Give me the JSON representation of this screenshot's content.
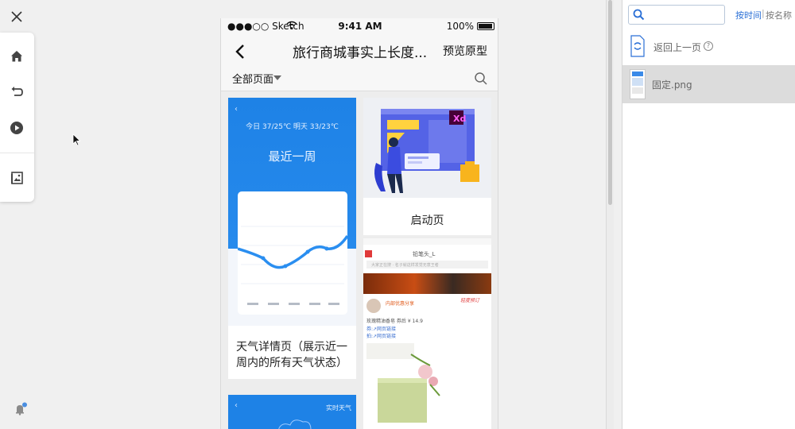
{
  "phone": {
    "status_bar": {
      "carrier": "●●●○○ Sketch",
      "time": "9:41 AM",
      "battery": "100%"
    },
    "nav": {
      "title": "旅行商城事实上长度...",
      "preview_label": "预览原型"
    },
    "filter": {
      "label": "全部页面"
    },
    "cards": {
      "weather": {
        "label": "天气详情页（展示近一周内的所有天气状态）",
        "temps": "今日 37/25℃    明天 33/23℃",
        "heading": "最近一周"
      },
      "launch": {
        "label": "启动页",
        "badge": "Xd"
      },
      "feed": {
        "header": "铅笔头_L",
        "search_hint": "大家正在搜 · 名子就这样发觉无意王者",
        "username": "内部优惠分享",
        "post_line1": "玫瑰精油香皂      券后 ¥ 14.9",
        "post_line2": "券:↗网页链接",
        "post_line3": "拍:↗网页链接",
        "tag": "轻度预订"
      },
      "weather2": {
        "label": "实时天气"
      }
    }
  },
  "right_panel": {
    "search_placeholder": "",
    "sort_by_time": "按时间",
    "sort_separator": "|",
    "sort_by_name": "按名称",
    "back_label": "返回上一页",
    "help": "?",
    "file_name": "固定.png"
  },
  "colors": {
    "accent": "#2a6fd6",
    "weather_blue": "#1e82e6",
    "highlight_row": "#dcdcdc"
  }
}
